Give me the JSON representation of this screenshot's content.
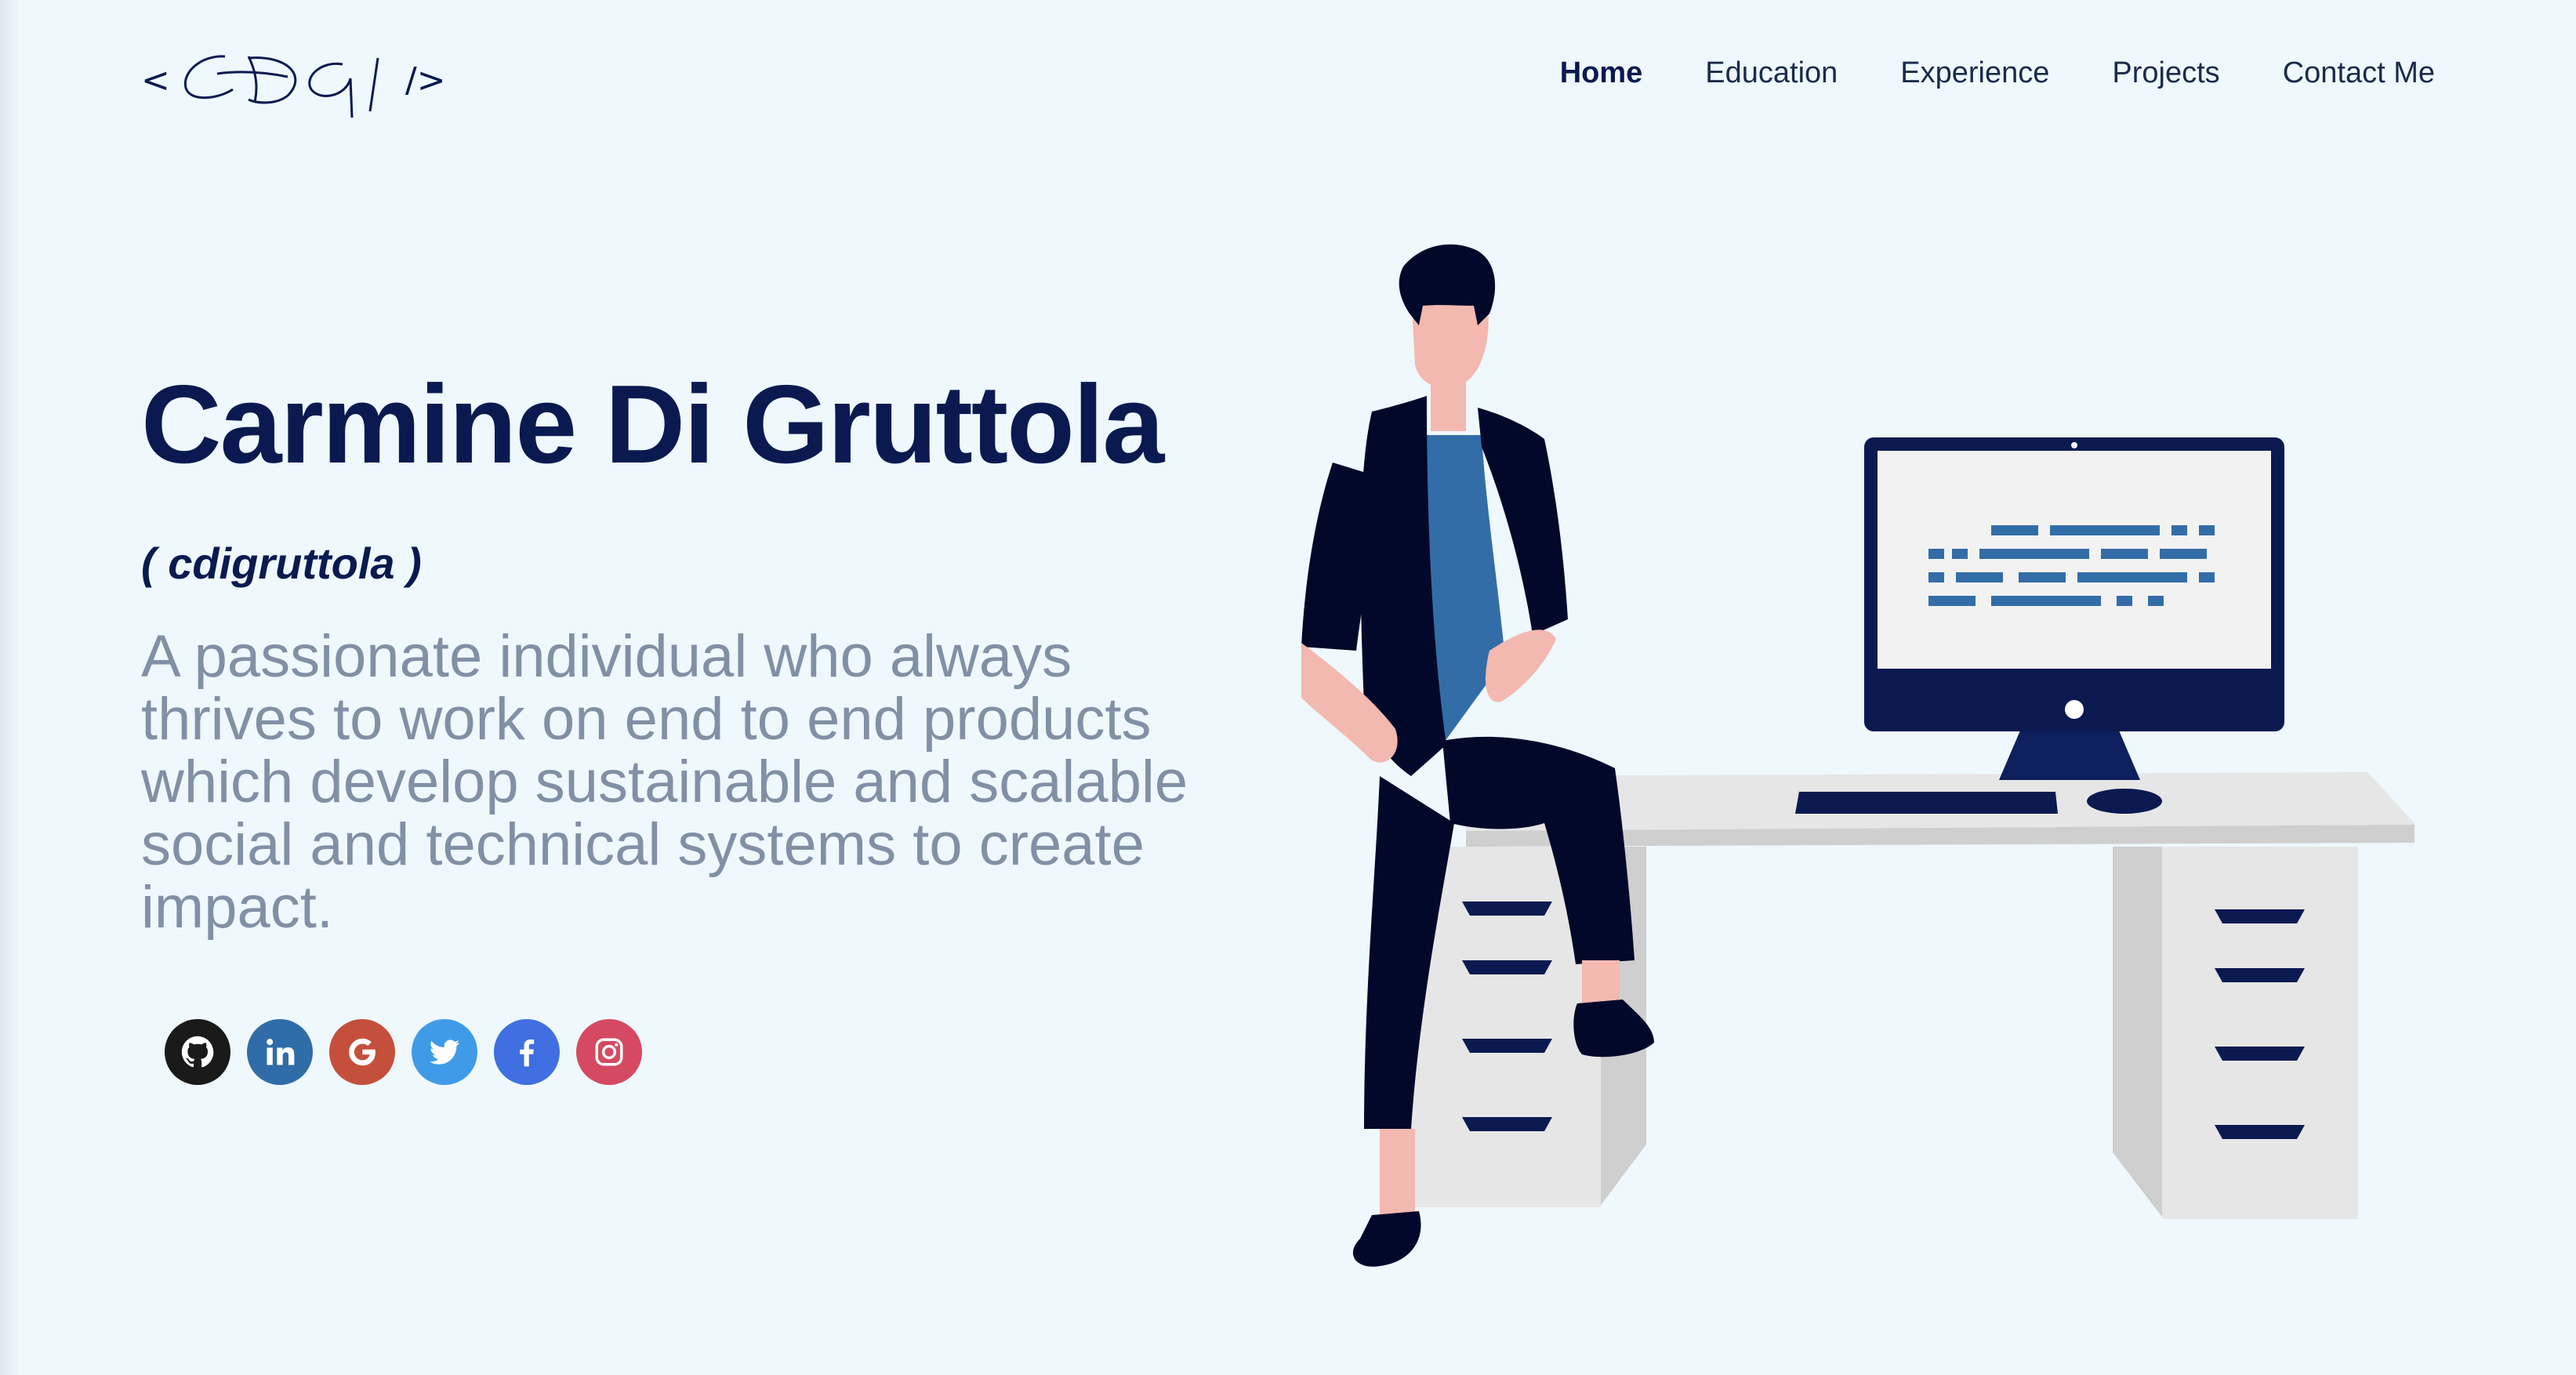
{
  "logo": {
    "open": "<",
    "close": "/>",
    "signature_text": "CDG"
  },
  "nav": {
    "items": [
      {
        "label": "Home",
        "active": true
      },
      {
        "label": "Education",
        "active": false
      },
      {
        "label": "Experience",
        "active": false
      },
      {
        "label": "Projects",
        "active": false
      },
      {
        "label": "Contact Me",
        "active": false
      }
    ]
  },
  "hero": {
    "name": "Carmine Di Gruttola",
    "handle": "( cdigruttola )",
    "description": "A passionate individual who always thrives to work on end to end products which develop sustainable and scalable social and technical systems to create impact."
  },
  "socials": [
    {
      "icon": "github-icon",
      "color": "#1a1a1a"
    },
    {
      "icon": "linkedin-icon",
      "color": "#2f6da8"
    },
    {
      "icon": "google-icon",
      "color": "#c4503c"
    },
    {
      "icon": "twitter-icon",
      "color": "#3f9be8"
    },
    {
      "icon": "facebook-icon",
      "color": "#3f6fe0"
    },
    {
      "icon": "instagram-icon",
      "color": "#d54a62"
    }
  ],
  "colors": {
    "background": "#eef8fd",
    "primary": "#0a1a50",
    "muted_text": "#8190a5",
    "accent_blue": "#336da8"
  }
}
